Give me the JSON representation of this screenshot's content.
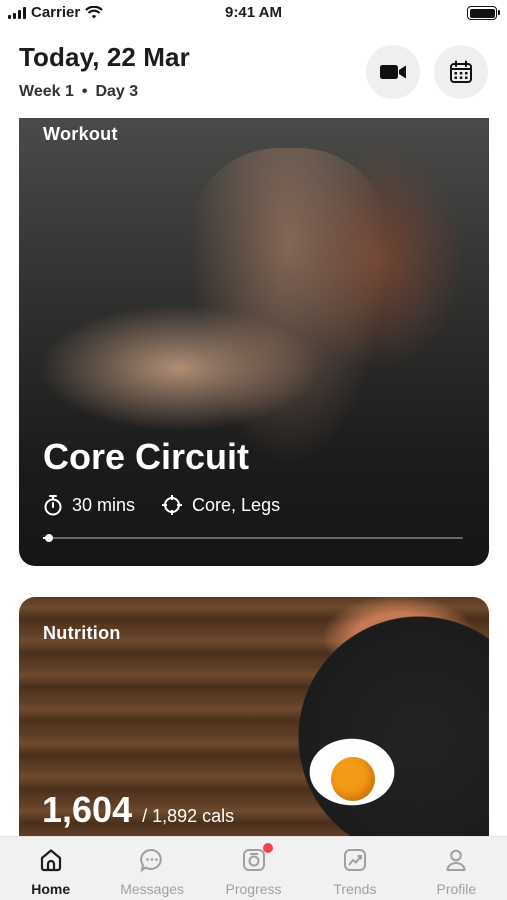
{
  "status_bar": {
    "carrier": "Carrier",
    "time": "9:41 AM"
  },
  "header": {
    "title": "Today, 22 Mar",
    "week": "Week 1",
    "separator": "•",
    "day": "Day 3",
    "video_icon": "video-camera-icon",
    "calendar_icon": "calendar-icon"
  },
  "workout_card": {
    "label": "Workout",
    "title": "Core Circuit",
    "duration": "30 mins",
    "focus": "Core, Legs",
    "progress": 0.01
  },
  "nutrition_card": {
    "label": "Nutrition",
    "calories_consumed": "1,604",
    "calories_goal": "/ 1,892 cals"
  },
  "tabbar": {
    "tabs": [
      {
        "label": "Home",
        "icon": "home-icon",
        "active": true
      },
      {
        "label": "Messages",
        "icon": "chat-bubble-icon",
        "active": false
      },
      {
        "label": "Progress",
        "icon": "progress-camera-icon",
        "active": false,
        "badge": true
      },
      {
        "label": "Trends",
        "icon": "trend-chart-icon",
        "active": false
      },
      {
        "label": "Profile",
        "icon": "person-icon",
        "active": false
      }
    ]
  },
  "colors": {
    "badge": "#f0464b",
    "tabbar_bg": "#f1f1f1",
    "inactive_tab": "#a0a0a0"
  }
}
